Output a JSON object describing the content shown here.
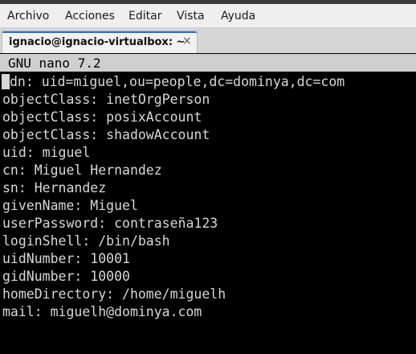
{
  "menubar": {
    "items": [
      "Archivo",
      "Acciones",
      "Editar",
      "Vista",
      "Ayuda"
    ]
  },
  "tab": {
    "title": "ignacio@ignacio-virtualbox: ~",
    "close_glyph": "×"
  },
  "nano": {
    "title": "GNU nano 7.2"
  },
  "editor": {
    "lines": [
      "dn: uid=miguel,ou=people,dc=dominya,dc=com",
      "objectClass: inetOrgPerson",
      "objectClass: posixAccount",
      "objectClass: shadowAccount",
      "uid: miguel",
      "cn: Miguel Hernandez",
      "sn: Hernandez",
      "givenName: Miguel",
      "userPassword: contraseña123",
      "loginShell: /bin/bash",
      "uidNumber: 10001",
      "gidNumber: 10000",
      "homeDirectory: /home/miguelh",
      "mail: miguelh@dominya.com"
    ]
  },
  "colors": {
    "terminal_bg": "#000000",
    "terminal_fg": "#d8d8d8",
    "nano_header_bg": "#cfcfcf",
    "tab_accent": "#2a6fc9"
  },
  "icons": {
    "tab_close": "close-icon"
  }
}
